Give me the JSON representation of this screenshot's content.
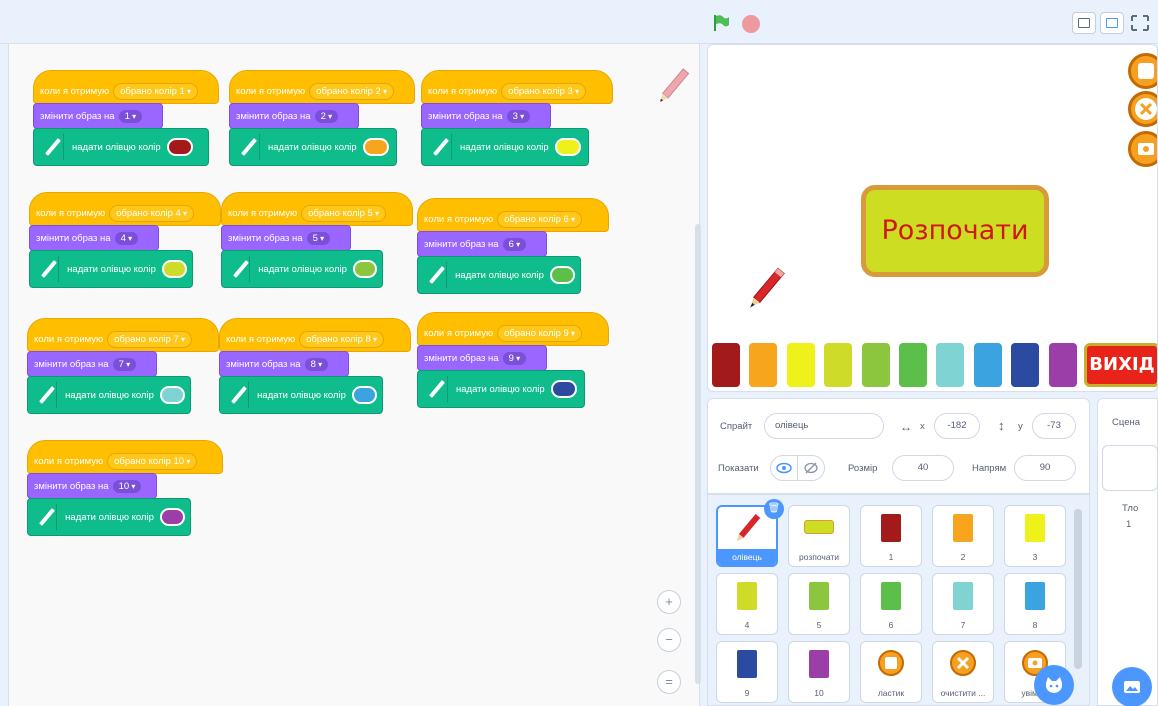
{
  "toolbar": {
    "flag_icon": "green-flag-icon",
    "stop_icon": "stop-icon"
  },
  "scripts": [
    {
      "hat": "коли я отримую",
      "msg": "обрано колір 1",
      "costume_label": "змінити образ на",
      "costume": "1",
      "pen_label": "надати олівцю колір",
      "color": "#a31a1a"
    },
    {
      "hat": "коли я отримую",
      "msg": "обрано колір 2",
      "costume_label": "змінити образ на",
      "costume": "2",
      "pen_label": "надати олівцю колір",
      "color": "#f7a51d"
    },
    {
      "hat": "коли я отримую",
      "msg": "обрано колір 3",
      "costume_label": "змінити образ на",
      "costume": "3",
      "pen_label": "надати олівцю колір",
      "color": "#eff21a"
    },
    {
      "hat": "коли я отримую",
      "msg": "обрано колір 4",
      "costume_label": "змінити образ на",
      "costume": "4",
      "pen_label": "надати олівцю колір",
      "color": "#cfdb29"
    },
    {
      "hat": "коли я отримую",
      "msg": "обрано колір 5",
      "costume_label": "змінити образ на",
      "costume": "5",
      "pen_label": "надати олівцю колір",
      "color": "#8cc63f"
    },
    {
      "hat": "коли я отримую",
      "msg": "обрано колір 6",
      "costume_label": "змінити образ на",
      "costume": "6",
      "pen_label": "надати олівцю колір",
      "color": "#5cbf49"
    },
    {
      "hat": "коли я отримую",
      "msg": "обрано колір 7",
      "costume_label": "змінити образ на",
      "costume": "7",
      "pen_label": "надати олівцю колір",
      "color": "#7fd3d3"
    },
    {
      "hat": "коли я отримую",
      "msg": "обрано колір 8",
      "costume_label": "змінити образ на",
      "costume": "8",
      "pen_label": "надати олівцю колір",
      "color": "#3aa3e0"
    },
    {
      "hat": "коли я отримую",
      "msg": "обрано колір 9",
      "costume_label": "змінити образ на",
      "costume": "9",
      "pen_label": "надати олівцю колір",
      "color": "#2b4aa0"
    },
    {
      "hat": "коли я отримую",
      "msg": "обрано колір 10",
      "costume_label": "змінити образ на",
      "costume": "10",
      "pen_label": "надати олівцю колір",
      "color": "#9b3ea8"
    }
  ],
  "zoom": {
    "in": "+",
    "out": "−",
    "reset": "="
  },
  "stage": {
    "start_label": "Розпочати",
    "exit_label": "ВИХІД",
    "palette": [
      "#a31a1a",
      "#f7a51d",
      "#eff21a",
      "#cfdb29",
      "#8cc63f",
      "#5cbf49",
      "#7fd3d3",
      "#3aa3e0",
      "#2b4aa0",
      "#9b3ea8"
    ]
  },
  "sprite_info": {
    "sprite_label": "Спрайт",
    "sprite_name": "олівець",
    "x_label": "x",
    "x_value": "-182",
    "y_label": "y",
    "y_value": "-73",
    "show_label": "Показати",
    "size_label": "Розмір",
    "size_value": "40",
    "direction_label": "Напрям",
    "direction_value": "90"
  },
  "sprites": [
    {
      "name": "олівець",
      "selected": true
    },
    {
      "name": "розпочати"
    },
    {
      "name": "1",
      "color": "#a31a1a"
    },
    {
      "name": "2",
      "color": "#f7a51d"
    },
    {
      "name": "3",
      "color": "#eff21a"
    },
    {
      "name": "4",
      "color": "#cfdb29"
    },
    {
      "name": "5",
      "color": "#8cc63f"
    },
    {
      "name": "6",
      "color": "#5cbf49"
    },
    {
      "name": "7",
      "color": "#7fd3d3"
    },
    {
      "name": "8",
      "color": "#3aa3e0"
    },
    {
      "name": "9",
      "color": "#2b4aa0"
    },
    {
      "name": "10",
      "color": "#9b3ea8"
    },
    {
      "name": "ластик"
    },
    {
      "name": "очистити ..."
    },
    {
      "name": "увімк..."
    }
  ],
  "scene": {
    "title": "Сцена",
    "backdrops_label": "Тло",
    "backdrops_count": "1"
  }
}
